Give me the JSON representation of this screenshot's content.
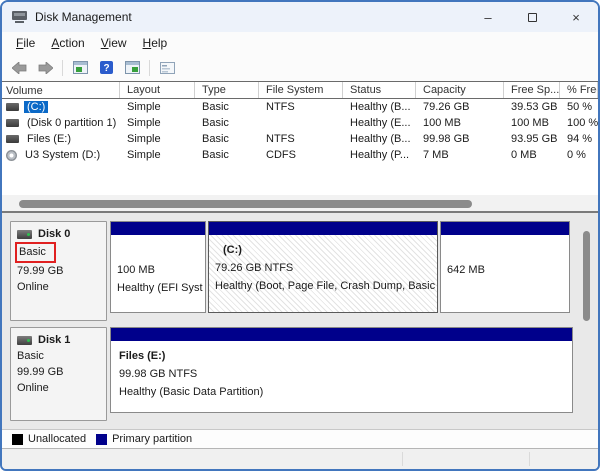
{
  "window": {
    "title": "Disk Management",
    "minimize_glyph": "–",
    "close_glyph": "×"
  },
  "menu": {
    "items": [
      {
        "label": "File"
      },
      {
        "label": "Action"
      },
      {
        "label": "View"
      },
      {
        "label": "Help"
      }
    ]
  },
  "toolbar": {
    "help_glyph": "?",
    "icons": [
      "back-icon",
      "forward-icon",
      "console-window-icon",
      "help-icon",
      "views-window-icon",
      "properties-icon"
    ]
  },
  "volume_table": {
    "columns": [
      "Volume",
      "Layout",
      "Type",
      "File System",
      "Status",
      "Capacity",
      "Free Sp...",
      "% Free"
    ],
    "rows": [
      {
        "volume": "(C:)",
        "layout": "Simple",
        "type": "Basic",
        "file_system": "NTFS",
        "status": "Healthy (B...",
        "capacity": "79.26 GB",
        "free_space": "39.53 GB",
        "pct_free": "50 %",
        "icon": "disk",
        "selected": true
      },
      {
        "volume": "(Disk 0 partition 1)",
        "layout": "Simple",
        "type": "Basic",
        "file_system": "",
        "status": "Healthy (E...",
        "capacity": "100 MB",
        "free_space": "100 MB",
        "pct_free": "100 %",
        "icon": "disk",
        "selected": false
      },
      {
        "volume": "Files (E:)",
        "layout": "Simple",
        "type": "Basic",
        "file_system": "NTFS",
        "status": "Healthy (B...",
        "capacity": "99.98 GB",
        "free_space": "93.95 GB",
        "pct_free": "94 %",
        "icon": "disk",
        "selected": false
      },
      {
        "volume": "U3 System (D:)",
        "layout": "Simple",
        "type": "Basic",
        "file_system": "CDFS",
        "status": "Healthy (P...",
        "capacity": "7 MB",
        "free_space": "0 MB",
        "pct_free": "0 %",
        "icon": "cd",
        "selected": false
      }
    ]
  },
  "disks": [
    {
      "name": "Disk 0",
      "type": "Basic",
      "size": "79.99 GB",
      "status": "Online",
      "annotated_field": "type",
      "partitions": [
        {
          "title": "",
          "line1": "100 MB",
          "line2": "Healthy (EFI Syst",
          "selected": false
        },
        {
          "title": "(C:)",
          "line1": "79.26 GB NTFS",
          "line2": "Healthy (Boot, Page File, Crash Dump, Basic",
          "selected": true
        },
        {
          "title": "",
          "line1": "642 MB",
          "line2": "",
          "selected": false
        }
      ]
    },
    {
      "name": "Disk 1",
      "type": "Basic",
      "size": "99.99 GB",
      "status": "Online",
      "partitions": [
        {
          "title": "Files  (E:)",
          "line1": "99.98 GB NTFS",
          "line2": "Healthy (Basic Data Partition)",
          "selected": false
        }
      ]
    }
  ],
  "legend": {
    "items": [
      {
        "label": "Unallocated",
        "color": "#000000"
      },
      {
        "label": "Primary partition",
        "color": "#00008b"
      }
    ]
  },
  "colors": {
    "window_border": "#4276bd",
    "titlebar_bg": "#edf2fa",
    "partition_bar": "#00008b",
    "selection_blue": "#0b69c7",
    "annotation_red": "#e02020"
  }
}
